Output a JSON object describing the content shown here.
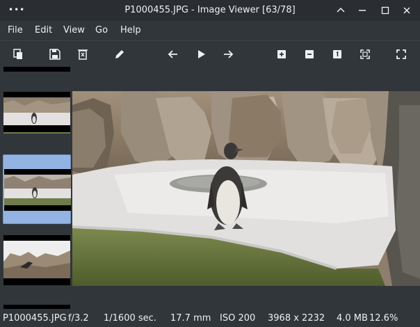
{
  "window": {
    "title": "P1000455.JPG - Image Viewer [63/78]",
    "menu_icon": "more-dots-icon",
    "controls": [
      "minimize-icon",
      "restore-icon",
      "maximize-icon",
      "close-icon"
    ]
  },
  "menu": {
    "items": [
      {
        "label": "File"
      },
      {
        "label": "Edit"
      },
      {
        "label": "View"
      },
      {
        "label": "Go"
      },
      {
        "label": "Help"
      }
    ]
  },
  "toolbar": {
    "buttons": [
      {
        "icon": "copy-icon"
      },
      {
        "icon": "save-icon"
      },
      {
        "icon": "delete-icon"
      },
      {
        "icon": "edit-pencil-icon"
      },
      {
        "icon": "previous-arrow-icon"
      },
      {
        "icon": "play-slideshow-icon"
      },
      {
        "icon": "next-arrow-icon"
      },
      {
        "icon": "zoom-in-icon"
      },
      {
        "icon": "zoom-out-icon"
      },
      {
        "icon": "original-size-icon"
      },
      {
        "icon": "zoom-fit-icon"
      },
      {
        "icon": "fullscreen-icon"
      }
    ]
  },
  "thumbnails": {
    "selected_index": 1,
    "items": [
      {
        "name": "thumb-previous"
      },
      {
        "name": "thumb-current"
      },
      {
        "name": "thumb-next"
      }
    ]
  },
  "status": {
    "filename": "P1000455.JPG",
    "aperture": "f/3.2",
    "shutter": "1/1600 sec.",
    "focal_length": "17.7 mm",
    "iso": "ISO 200",
    "dimensions": "3968 x 2232",
    "filesize": "4.0 MB",
    "zoom": "12.6%"
  },
  "colors": {
    "window_bg": "#31363b",
    "titlebar_bg": "#2a2e32",
    "selection": "#93b3e3",
    "text": "#eff0f1"
  }
}
